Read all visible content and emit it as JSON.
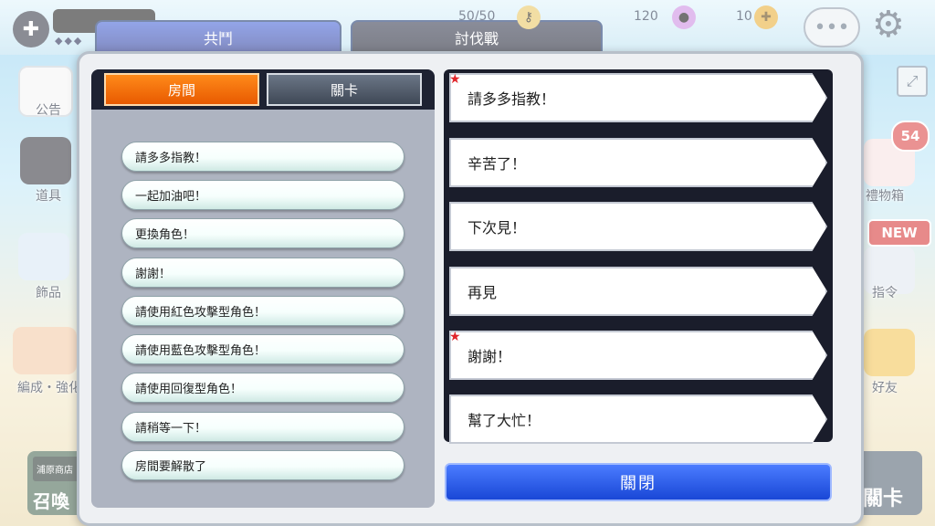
{
  "hud": {
    "tab_left": "共鬥",
    "tab_right": "討伐戰",
    "stamina": "50/50",
    "gems": "120",
    "tickets": "10",
    "diamonds": "◆◆◆"
  },
  "side_left": [
    {
      "label": "公告"
    },
    {
      "label": "道具"
    },
    {
      "label": "飾品"
    },
    {
      "label": "編成・強化"
    }
  ],
  "side_right": [
    {
      "label": "禮物箱"
    },
    {
      "label": "指令"
    },
    {
      "label": "好友"
    }
  ],
  "badges": {
    "gifts": "54",
    "new": "NEW"
  },
  "bottom": {
    "left_label": "浦原商店",
    "left_caption": "召喚",
    "right_label": "關卡"
  },
  "dialog": {
    "tabs": [
      {
        "label": "房間"
      },
      {
        "label": "關卡"
      }
    ],
    "phrases": [
      "請多多指教！",
      "一起加油吧！",
      "更換角色！",
      "謝謝！",
      "請使用紅色攻擊型角色！",
      "請使用藍色攻擊型角色！",
      "請使用回復型角色！",
      "請稍等一下！",
      "房間要解散了"
    ],
    "messages": [
      {
        "text": "請多多指教！",
        "starred": true
      },
      {
        "text": "辛苦了！",
        "starred": false
      },
      {
        "text": "下次見！",
        "starred": false
      },
      {
        "text": "再見",
        "starred": false
      },
      {
        "text": "謝謝！",
        "starred": true
      },
      {
        "text": "幫了大忙！",
        "starred": false
      }
    ],
    "close_label": "關閉"
  },
  "colors": {
    "accent_orange": "#f2740c",
    "close_blue": "#1f55e6",
    "panel_dark": "#1a1d2b"
  }
}
